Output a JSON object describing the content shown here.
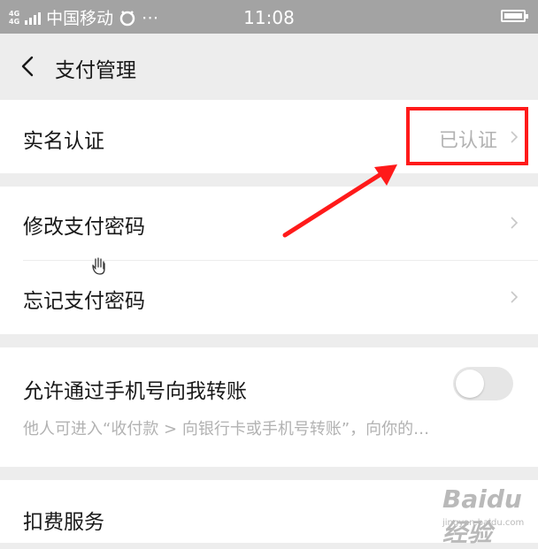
{
  "status_bar": {
    "network_type": "4G",
    "carrier": "中国移动",
    "time": "11:08",
    "extra_icons": "⋯"
  },
  "header": {
    "title": "支付管理"
  },
  "rows": {
    "real_name": {
      "label": "实名认证",
      "value": "已认证"
    },
    "change_password": {
      "label": "修改支付密码"
    },
    "forgot_password": {
      "label": "忘记支付密码"
    },
    "allow_transfer": {
      "label": "允许通过手机号向我转账",
      "description": "他人可进入“收付款 > 向银行卡或手机号转账”，向你的…",
      "toggle_on": false
    },
    "deduction_services": {
      "label": "扣费服务"
    }
  },
  "annotation": {
    "highlight_color": "#ff1a1a"
  },
  "watermark": {
    "logo": "Baidu 经验",
    "url": "jingyan.baidu.com"
  },
  "colors": {
    "status_bar": "#a3a3a3",
    "background": "#ededed",
    "secondary_text": "#b2b2b2"
  }
}
